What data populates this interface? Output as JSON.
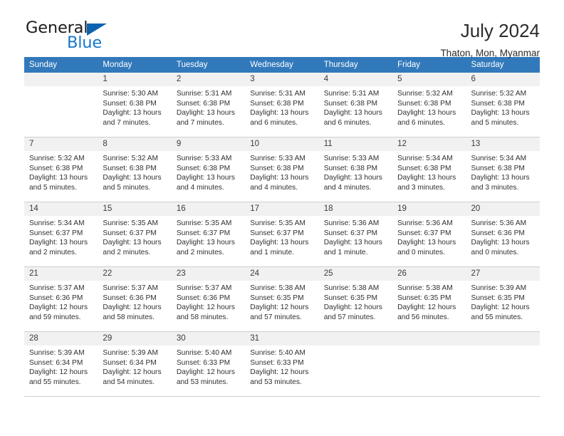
{
  "brand": {
    "name_part1": "General",
    "name_part2": "Blue",
    "triangle_color": "#0d62b0",
    "blue_color": "#1878c8"
  },
  "header": {
    "title": "July 2024",
    "subtitle": "Thaton, Mon, Myanmar",
    "header_bg": "#3279bb",
    "daynum_bg": "#f1f1f1"
  },
  "weekdays": [
    "Sunday",
    "Monday",
    "Tuesday",
    "Wednesday",
    "Thursday",
    "Friday",
    "Saturday"
  ],
  "weeks": [
    [
      {
        "day": ""
      },
      {
        "day": "1",
        "sunrise": "Sunrise: 5:30 AM",
        "sunset": "Sunset: 6:38 PM",
        "daylight1": "Daylight: 13 hours",
        "daylight2": "and 7 minutes."
      },
      {
        "day": "2",
        "sunrise": "Sunrise: 5:31 AM",
        "sunset": "Sunset: 6:38 PM",
        "daylight1": "Daylight: 13 hours",
        "daylight2": "and 7 minutes."
      },
      {
        "day": "3",
        "sunrise": "Sunrise: 5:31 AM",
        "sunset": "Sunset: 6:38 PM",
        "daylight1": "Daylight: 13 hours",
        "daylight2": "and 6 minutes."
      },
      {
        "day": "4",
        "sunrise": "Sunrise: 5:31 AM",
        "sunset": "Sunset: 6:38 PM",
        "daylight1": "Daylight: 13 hours",
        "daylight2": "and 6 minutes."
      },
      {
        "day": "5",
        "sunrise": "Sunrise: 5:32 AM",
        "sunset": "Sunset: 6:38 PM",
        "daylight1": "Daylight: 13 hours",
        "daylight2": "and 6 minutes."
      },
      {
        "day": "6",
        "sunrise": "Sunrise: 5:32 AM",
        "sunset": "Sunset: 6:38 PM",
        "daylight1": "Daylight: 13 hours",
        "daylight2": "and 5 minutes."
      }
    ],
    [
      {
        "day": "7",
        "sunrise": "Sunrise: 5:32 AM",
        "sunset": "Sunset: 6:38 PM",
        "daylight1": "Daylight: 13 hours",
        "daylight2": "and 5 minutes."
      },
      {
        "day": "8",
        "sunrise": "Sunrise: 5:32 AM",
        "sunset": "Sunset: 6:38 PM",
        "daylight1": "Daylight: 13 hours",
        "daylight2": "and 5 minutes."
      },
      {
        "day": "9",
        "sunrise": "Sunrise: 5:33 AM",
        "sunset": "Sunset: 6:38 PM",
        "daylight1": "Daylight: 13 hours",
        "daylight2": "and 4 minutes."
      },
      {
        "day": "10",
        "sunrise": "Sunrise: 5:33 AM",
        "sunset": "Sunset: 6:38 PM",
        "daylight1": "Daylight: 13 hours",
        "daylight2": "and 4 minutes."
      },
      {
        "day": "11",
        "sunrise": "Sunrise: 5:33 AM",
        "sunset": "Sunset: 6:38 PM",
        "daylight1": "Daylight: 13 hours",
        "daylight2": "and 4 minutes."
      },
      {
        "day": "12",
        "sunrise": "Sunrise: 5:34 AM",
        "sunset": "Sunset: 6:38 PM",
        "daylight1": "Daylight: 13 hours",
        "daylight2": "and 3 minutes."
      },
      {
        "day": "13",
        "sunrise": "Sunrise: 5:34 AM",
        "sunset": "Sunset: 6:38 PM",
        "daylight1": "Daylight: 13 hours",
        "daylight2": "and 3 minutes."
      }
    ],
    [
      {
        "day": "14",
        "sunrise": "Sunrise: 5:34 AM",
        "sunset": "Sunset: 6:37 PM",
        "daylight1": "Daylight: 13 hours",
        "daylight2": "and 2 minutes."
      },
      {
        "day": "15",
        "sunrise": "Sunrise: 5:35 AM",
        "sunset": "Sunset: 6:37 PM",
        "daylight1": "Daylight: 13 hours",
        "daylight2": "and 2 minutes."
      },
      {
        "day": "16",
        "sunrise": "Sunrise: 5:35 AM",
        "sunset": "Sunset: 6:37 PM",
        "daylight1": "Daylight: 13 hours",
        "daylight2": "and 2 minutes."
      },
      {
        "day": "17",
        "sunrise": "Sunrise: 5:35 AM",
        "sunset": "Sunset: 6:37 PM",
        "daylight1": "Daylight: 13 hours",
        "daylight2": "and 1 minute."
      },
      {
        "day": "18",
        "sunrise": "Sunrise: 5:36 AM",
        "sunset": "Sunset: 6:37 PM",
        "daylight1": "Daylight: 13 hours",
        "daylight2": "and 1 minute."
      },
      {
        "day": "19",
        "sunrise": "Sunrise: 5:36 AM",
        "sunset": "Sunset: 6:37 PM",
        "daylight1": "Daylight: 13 hours",
        "daylight2": "and 0 minutes."
      },
      {
        "day": "20",
        "sunrise": "Sunrise: 5:36 AM",
        "sunset": "Sunset: 6:36 PM",
        "daylight1": "Daylight: 13 hours",
        "daylight2": "and 0 minutes."
      }
    ],
    [
      {
        "day": "21",
        "sunrise": "Sunrise: 5:37 AM",
        "sunset": "Sunset: 6:36 PM",
        "daylight1": "Daylight: 12 hours",
        "daylight2": "and 59 minutes."
      },
      {
        "day": "22",
        "sunrise": "Sunrise: 5:37 AM",
        "sunset": "Sunset: 6:36 PM",
        "daylight1": "Daylight: 12 hours",
        "daylight2": "and 58 minutes."
      },
      {
        "day": "23",
        "sunrise": "Sunrise: 5:37 AM",
        "sunset": "Sunset: 6:36 PM",
        "daylight1": "Daylight: 12 hours",
        "daylight2": "and 58 minutes."
      },
      {
        "day": "24",
        "sunrise": "Sunrise: 5:38 AM",
        "sunset": "Sunset: 6:35 PM",
        "daylight1": "Daylight: 12 hours",
        "daylight2": "and 57 minutes."
      },
      {
        "day": "25",
        "sunrise": "Sunrise: 5:38 AM",
        "sunset": "Sunset: 6:35 PM",
        "daylight1": "Daylight: 12 hours",
        "daylight2": "and 57 minutes."
      },
      {
        "day": "26",
        "sunrise": "Sunrise: 5:38 AM",
        "sunset": "Sunset: 6:35 PM",
        "daylight1": "Daylight: 12 hours",
        "daylight2": "and 56 minutes."
      },
      {
        "day": "27",
        "sunrise": "Sunrise: 5:39 AM",
        "sunset": "Sunset: 6:35 PM",
        "daylight1": "Daylight: 12 hours",
        "daylight2": "and 55 minutes."
      }
    ],
    [
      {
        "day": "28",
        "sunrise": "Sunrise: 5:39 AM",
        "sunset": "Sunset: 6:34 PM",
        "daylight1": "Daylight: 12 hours",
        "daylight2": "and 55 minutes."
      },
      {
        "day": "29",
        "sunrise": "Sunrise: 5:39 AM",
        "sunset": "Sunset: 6:34 PM",
        "daylight1": "Daylight: 12 hours",
        "daylight2": "and 54 minutes."
      },
      {
        "day": "30",
        "sunrise": "Sunrise: 5:40 AM",
        "sunset": "Sunset: 6:33 PM",
        "daylight1": "Daylight: 12 hours",
        "daylight2": "and 53 minutes."
      },
      {
        "day": "31",
        "sunrise": "Sunrise: 5:40 AM",
        "sunset": "Sunset: 6:33 PM",
        "daylight1": "Daylight: 12 hours",
        "daylight2": "and 53 minutes."
      },
      {
        "day": ""
      },
      {
        "day": ""
      },
      {
        "day": ""
      }
    ]
  ]
}
